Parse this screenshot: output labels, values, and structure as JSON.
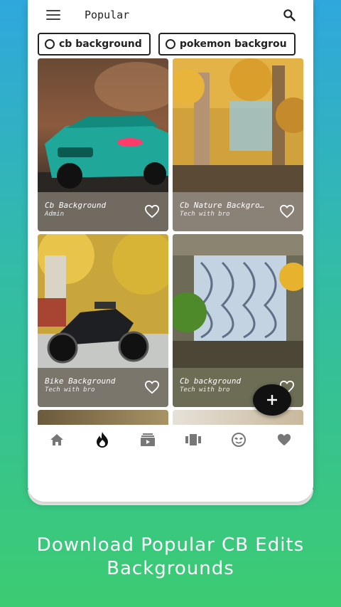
{
  "appbar": {
    "title": "Popular",
    "menu_icon": "menu-icon",
    "search_icon": "search-icon"
  },
  "chips": [
    {
      "label": "cb background",
      "selected": false
    },
    {
      "label": "pokemon backgrou",
      "selected": false
    }
  ],
  "wallpapers": [
    {
      "name": "Cb Background",
      "author": "Admin",
      "image": "teal-bmw-car",
      "info_color": "#706a61"
    },
    {
      "name": "Cb Nature Backgro…",
      "author": "Tech with bro",
      "image": "autumn-trees",
      "info_color": "#8a8276"
    },
    {
      "name": "Bike Background",
      "author": "Tech with bro",
      "image": "motorbike-yellow-trees",
      "info_color": "#7a766b"
    },
    {
      "name": "Cb background",
      "author": "Tech with bro",
      "image": "ornate-gate-plant",
      "info_color": "#6d6c55"
    }
  ],
  "fab": {
    "icon": "plus-icon"
  },
  "bottom_nav": [
    {
      "icon": "home-icon",
      "active": false
    },
    {
      "icon": "fire-icon",
      "active": true
    },
    {
      "icon": "collections-icon",
      "active": false
    },
    {
      "icon": "carousel-icon",
      "active": false
    },
    {
      "icon": "mask-icon",
      "active": false
    },
    {
      "icon": "heart-icon",
      "active": false
    }
  ],
  "colors": {
    "nav_icon": "#777777",
    "nav_active": "#111111",
    "background_top": "#2fa7dd",
    "background_bottom": "#3ccb72"
  },
  "tagline": {
    "line1": "Download Popular CB Edits",
    "line2": "Backgrounds"
  }
}
